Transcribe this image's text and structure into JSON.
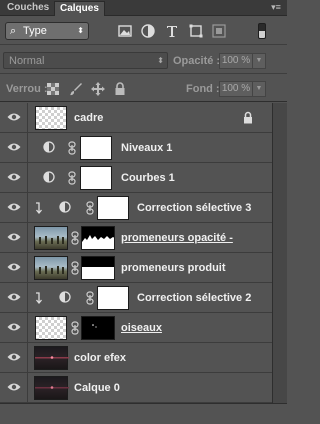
{
  "tabs": {
    "inactive": "Couches",
    "active": "Calques"
  },
  "filter": {
    "kind_label": "Type",
    "icons": [
      "image-filter-icon",
      "adjustment-filter-icon",
      "type-filter-icon",
      "shape-filter-icon",
      "smart-object-filter-icon"
    ]
  },
  "blend": {
    "mode": "Normal",
    "opacity_label": "Opacité :",
    "opacity_value": "100 %"
  },
  "lock": {
    "label": "Verrou :",
    "fill_label": "Fond :",
    "fill_value": "100 %"
  },
  "layers": [
    {
      "name": "cadre",
      "thumb": "checker",
      "locked": true
    },
    {
      "name": "Niveaux 1",
      "adjustment": "levels",
      "mask": "white"
    },
    {
      "name": "Courbes 1",
      "adjustment": "curves",
      "mask": "white"
    },
    {
      "name": "Correction sélective 3",
      "adjustment": "selective-color",
      "mask": "white",
      "clipped": true
    },
    {
      "name": "promeneurs opacité -",
      "thumb": "photo",
      "mask": "silhouette-mask",
      "underline": true
    },
    {
      "name": "promeneurs produit",
      "thumb": "photo",
      "mask": "half-mask"
    },
    {
      "name": "Correction sélective 2",
      "adjustment": "selective-color",
      "mask": "white",
      "clipped": true
    },
    {
      "name": "oiseaux",
      "thumb": "checker",
      "mask": "black",
      "underline": true
    },
    {
      "name": "color efex",
      "thumb": "dark"
    },
    {
      "name": "Calque 0",
      "thumb": "dark"
    }
  ],
  "colors": {
    "panel": "#535353",
    "tabbar": "#3a3a3a",
    "text": "#f0f0f0"
  }
}
